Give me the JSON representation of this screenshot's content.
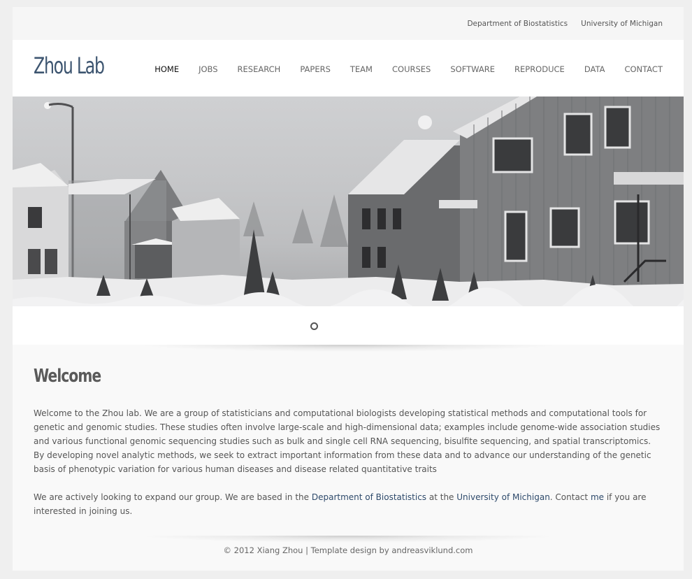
{
  "topbar": {
    "links": [
      "Department of Biostatistics",
      "University of Michigan"
    ]
  },
  "header": {
    "logo": "Zhou Lab",
    "nav": [
      "HOME",
      "JOBS",
      "RESEARCH",
      "PAPERS",
      "TEAM",
      "COURSES",
      "SOFTWARE",
      "REPRODUCE",
      "DATA",
      "CONTACT"
    ],
    "active_nav": "HOME"
  },
  "colors": {
    "logo": "#3d5570",
    "link": "#2e4a6b",
    "page_bg": "#efefef"
  },
  "main": {
    "title": "Welcome",
    "intro": "Welcome to the Zhou lab. We are a group of statisticians and computational biologists developing statistical methods and computational tools for genetic and genomic studies. These studies often involve large-scale and high-dimensional data; examples include genome-wide association studies and various functional genomic sequencing studies such as bulk and single cell RNA sequencing, bisulfite sequencing, and spatial transcriptomics. By developing novel analytic methods, we seek to extract important information from these data and to advance our understanding of the genetic basis of phenotypic variation for various human diseases and disease related quantitative traits",
    "join": {
      "part1": "We are actively looking to expand our group. We are based in the ",
      "link1": "Department of Biostatistics",
      "part2": " at the ",
      "link2": "University of Michigan",
      "part3": ". Contact ",
      "link3": "me",
      "part4": " if you are interested in joining us."
    }
  },
  "footer": {
    "text": "© 2012 Xiang Zhou | Template design by andreasviklund.com"
  }
}
